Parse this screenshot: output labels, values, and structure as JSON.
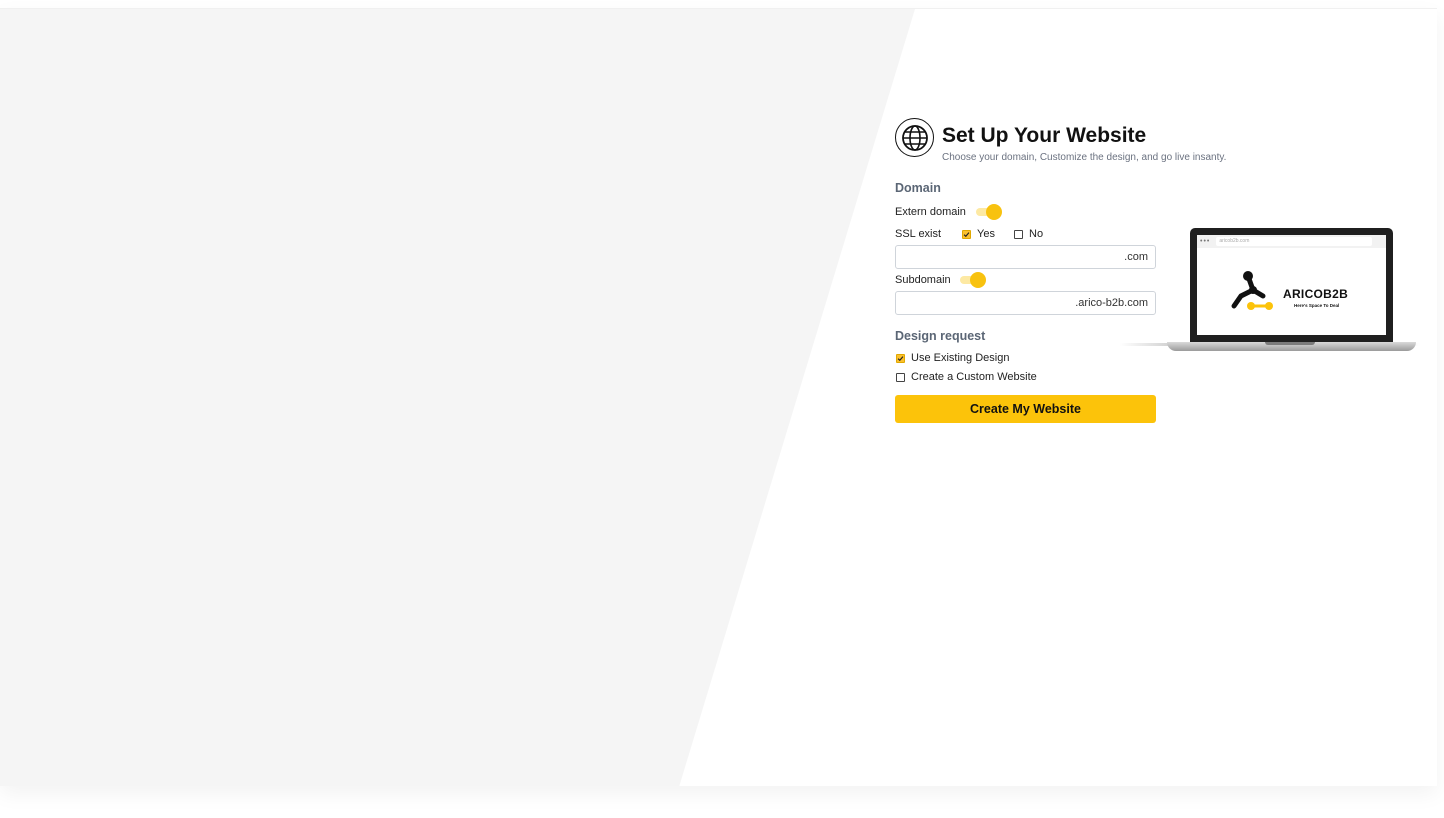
{
  "header": {
    "title": "Set Up Your Website",
    "subtitle": "Choose your domain, Customize the design, and go live insanty.",
    "icon": "globe-icon"
  },
  "domain": {
    "section_label": "Domain",
    "extern_domain": {
      "label": "Extern domain",
      "on": true
    },
    "ssl": {
      "label": "SSL exist",
      "options": [
        {
          "label": "Yes",
          "checked": true
        },
        {
          "label": "No",
          "checked": false
        }
      ]
    },
    "domain_input": {
      "value": "",
      "suffix": ".com"
    },
    "subdomain": {
      "label": "Subdomain",
      "on": true
    },
    "subdomain_input": {
      "value": "",
      "suffix": ".arico-b2b.com"
    }
  },
  "design": {
    "section_label": "Design request",
    "options": [
      {
        "label": "Use Existing Design",
        "checked": true
      },
      {
        "label": "Create a Custom Website",
        "checked": false
      }
    ]
  },
  "actions": {
    "create_label": "Create My Website"
  },
  "preview": {
    "url": "aricob2b.com",
    "brand": "ARICOB2B",
    "tagline": "Here's Space To Deal"
  },
  "colors": {
    "accent": "#fcc30a",
    "panel": "#f5f5f5",
    "section_label": "#5b6675"
  }
}
